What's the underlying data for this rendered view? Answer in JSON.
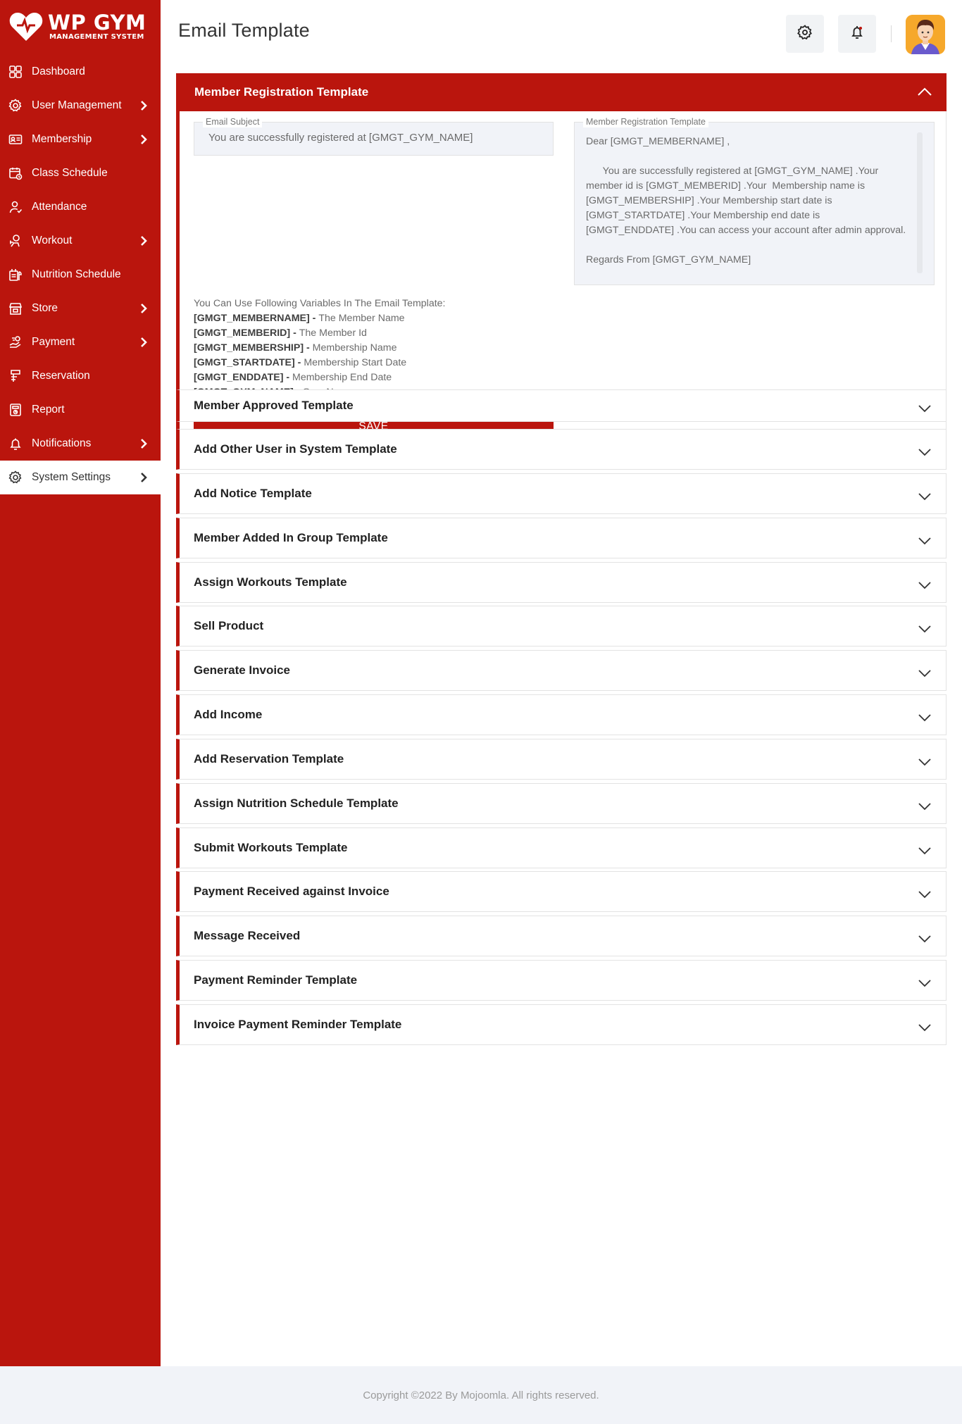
{
  "sidebar": {
    "logo_title": "WP GYM",
    "logo_subtitle": "MANAGEMENT SYSTEM",
    "items": [
      {
        "label": "Dashboard",
        "icon": "dashboard-icon",
        "has_submenu": false,
        "active": false
      },
      {
        "label": "User Management",
        "icon": "user-management-icon",
        "has_submenu": true,
        "active": false
      },
      {
        "label": "Membership",
        "icon": "membership-card-icon",
        "has_submenu": true,
        "active": false
      },
      {
        "label": "Class Schedule",
        "icon": "calendar-icon",
        "has_submenu": false,
        "active": false
      },
      {
        "label": "Attendance",
        "icon": "attendance-user-icon",
        "has_submenu": false,
        "active": false
      },
      {
        "label": "Workout",
        "icon": "workout-icon",
        "has_submenu": true,
        "active": false
      },
      {
        "label": "Nutrition Schedule",
        "icon": "nutrition-icon",
        "has_submenu": false,
        "active": false
      },
      {
        "label": "Store",
        "icon": "store-icon",
        "has_submenu": true,
        "active": false
      },
      {
        "label": "Payment",
        "icon": "payment-icon",
        "has_submenu": true,
        "active": false
      },
      {
        "label": "Reservation",
        "icon": "reservation-icon",
        "has_submenu": false,
        "active": false
      },
      {
        "label": "Report",
        "icon": "report-icon",
        "has_submenu": false,
        "active": false
      },
      {
        "label": "Notifications",
        "icon": "bell-icon",
        "has_submenu": true,
        "active": false
      },
      {
        "label": "System Settings",
        "icon": "gear-icon",
        "has_submenu": true,
        "active": true
      }
    ]
  },
  "header": {
    "title": "Email Template",
    "settings_icon": "gear-icon",
    "notification_icon": "bell-icon",
    "avatar_icon": "user-avatar-icon"
  },
  "open_panel": {
    "title": "Member Registration Template",
    "subject_label": "Email Subject",
    "subject_value": "You are successfully registered at [GMGT_GYM_NAME]",
    "body_label": "Member Registration Template",
    "body_value": "Dear [GMGT_MEMBERNAME] ,\n\n      You are successfully registered at [GMGT_GYM_NAME] .Your member id is [GMGT_MEMBERID] .Your  Membership name is [GMGT_MEMBERSHIP] .Your Membership start date is [GMGT_STARTDATE] .Your Membership end date is [GMGT_ENDDATE] .You can access your account after admin approval.\n\nRegards From [GMGT_GYM_NAME]",
    "variables_heading": "You Can Use Following Variables In The Email Template:",
    "variables": [
      {
        "code": "[GMGT_MEMBERNAME]",
        "desc": "The Member Name"
      },
      {
        "code": "[GMGT_MEMBERID]",
        "desc": "The Member Id"
      },
      {
        "code": "[GMGT_MEMBERSHIP]",
        "desc": "Membership Name"
      },
      {
        "code": "[GMGT_STARTDATE]",
        "desc": "Membership Start Date"
      },
      {
        "code": "[GMGT_ENDDATE]",
        "desc": "Membership End Date"
      },
      {
        "code": "[GMGT_GYM_NAME]",
        "desc": "Gym Name"
      }
    ],
    "save_label": "SAVE"
  },
  "collapsed_panels": [
    "Member Approved Template",
    "Add Other User in System Template",
    "Add Notice Template",
    "Member Added In Group Template",
    "Assign Workouts Template",
    "Sell Product",
    "Generate Invoice",
    "Add Income",
    "Add Reservation Template",
    "Assign Nutrition Schedule Template",
    "Submit Workouts Template",
    "Payment Received against Invoice",
    "Message Received",
    "Payment Reminder Template",
    "Invoice Payment Reminder Template"
  ],
  "footer": {
    "text": "Copyright ©2022 By Mojoomla. All rights reserved."
  },
  "colors": {
    "brand_red": "#ba150d",
    "footer_bg": "#f1f3f8",
    "avatar_bg": "#f6a82b"
  }
}
